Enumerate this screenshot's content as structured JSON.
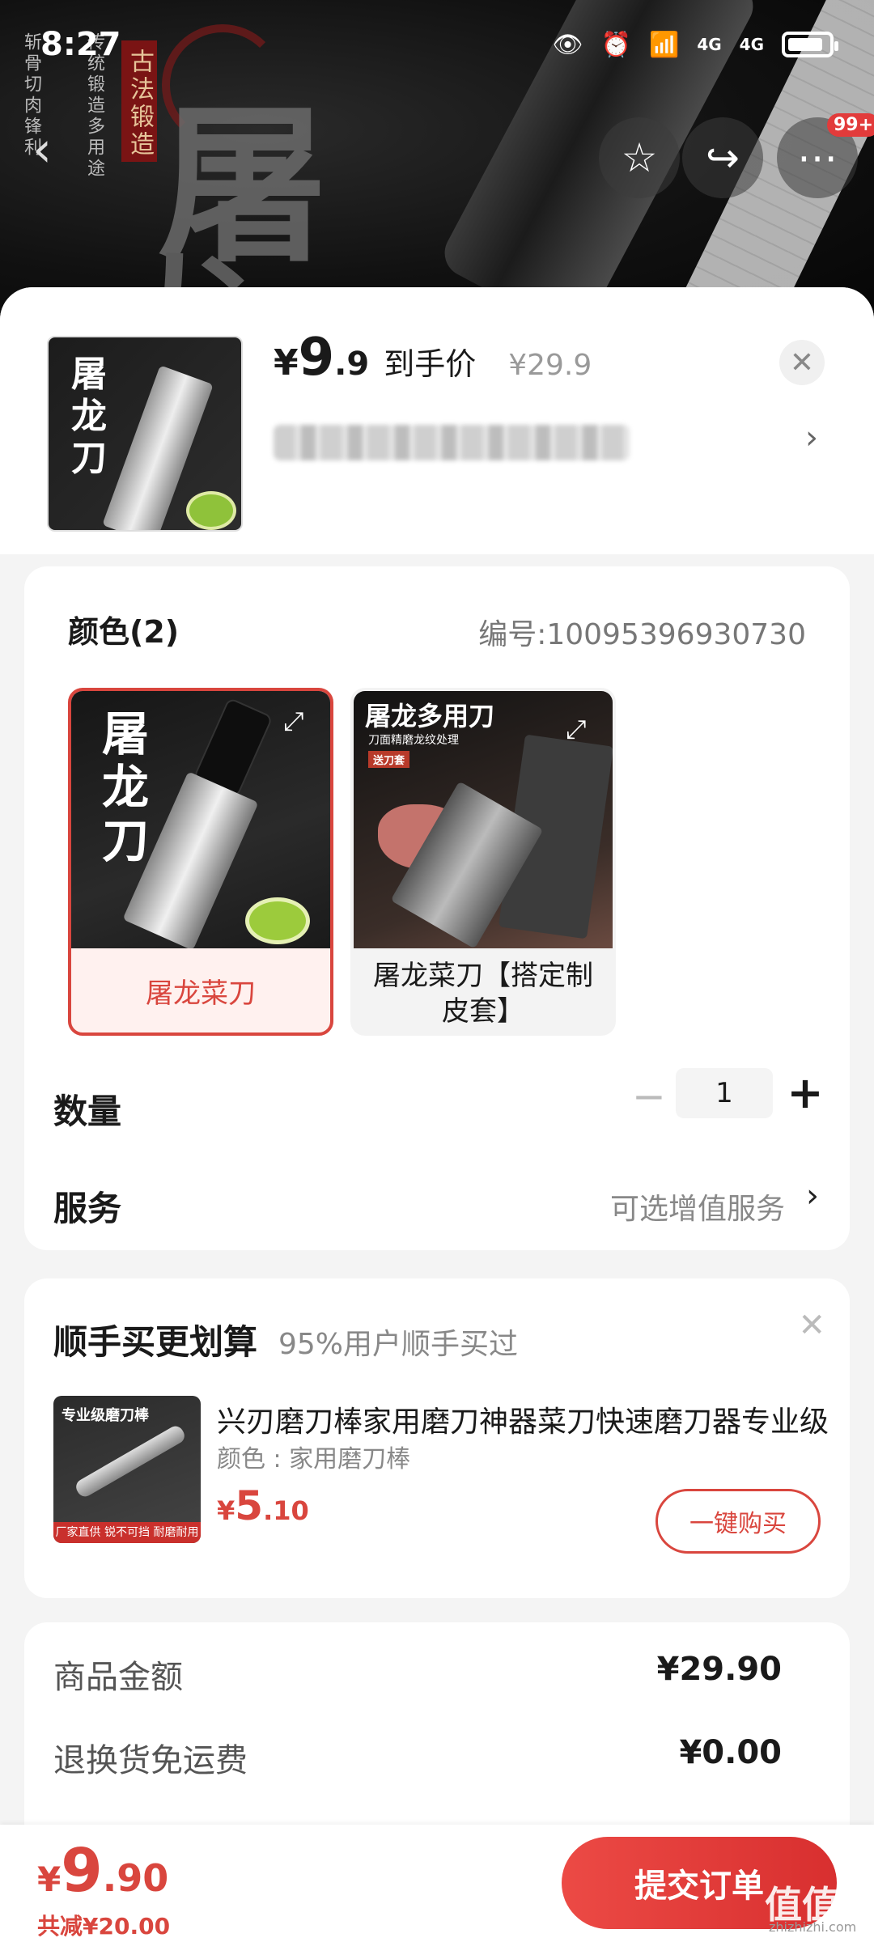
{
  "status_bar": {
    "time": "8:27",
    "signal1": "4G",
    "signal2": "4G"
  },
  "banner": {
    "big_char_1": "屠",
    "big_char_2": "龙",
    "seal_text": "古法锻造",
    "vertical_text_1": "传统锻造多用途",
    "vertical_text_2": "斩骨切肉锋利",
    "notification_count": "99+"
  },
  "header": {
    "price_yen": "¥",
    "price_int": "9",
    "price_dec": ".9",
    "price_label": "到手价",
    "original_price": "¥29.9",
    "thumb_title": "屠龙刀"
  },
  "spec": {
    "color_title": "颜色(2)",
    "sku_no": "编号:10095396930730",
    "variants": [
      {
        "label": "屠龙菜刀",
        "img_title": "屠龙刀",
        "selected": true
      },
      {
        "label": "屠龙菜刀【搭定制皮套】",
        "img_title": "屠龙多用刀",
        "img_sub": "刀面精磨龙纹处理",
        "img_tag": "送刀套",
        "selected": false
      }
    ],
    "quantity_label": "数量",
    "quantity_value": "1",
    "service_label": "服务",
    "service_value": "可选增值服务"
  },
  "addon": {
    "title": "顺手买更划算",
    "subtitle": "95%用户顺手买过",
    "product_name": "兴刃磨刀棒家用磨刀神器菜刀快速磨刀器专业级",
    "product_spec": "颜色 : 家用磨刀棒",
    "price_yen": "¥",
    "price_int": "5",
    "price_dec": ".10",
    "buy_label": "一键购买",
    "thumb_title": "专业级磨刀棒",
    "thumb_bar": "厂家直供 锐不可挡 耐磨耐用"
  },
  "amounts": [
    {
      "key": "商品金额",
      "value": "¥29.90"
    },
    {
      "key": "退换货免运费",
      "value": "¥0.00"
    }
  ],
  "bottom_bar": {
    "price_yen": "¥",
    "price_int": "9",
    "price_dec": ".90",
    "saving": "共减¥20.00",
    "submit_label": "提交订单",
    "watermark": "值值值",
    "watermark_sub": "zhizhizhi.com"
  },
  "colors": {
    "accent": "#d9463e",
    "button_gradient_start": "#ec4a45"
  }
}
